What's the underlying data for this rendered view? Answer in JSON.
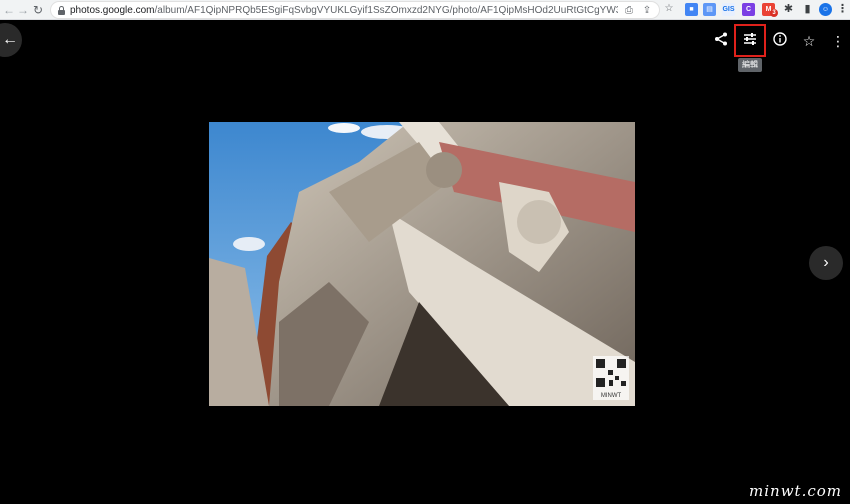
{
  "browser": {
    "url_host": "photos.google.com",
    "url_path": "/album/AF1QipNPRQb5ESgiFqSvbgVYUKLGyif1SsZOmxzd2NYG/photo/AF1QipMsHOd2UuRtGtCgYW3EbRVOgdyW-...",
    "extension_badge": "3"
  },
  "viewer": {
    "edit_tooltip": "編輯"
  },
  "photo": {
    "qr_caption": "MINWT"
  },
  "watermark": "minwt.com"
}
